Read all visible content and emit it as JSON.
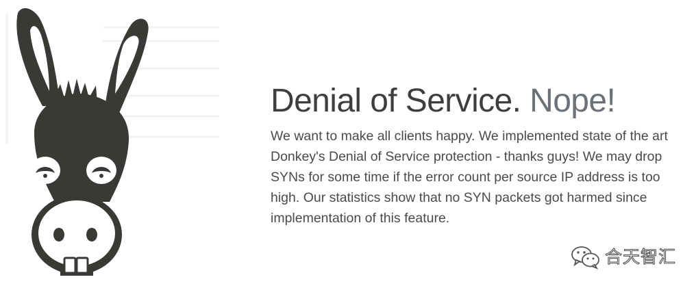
{
  "headline": {
    "main": "Denial of Service.",
    "accent": "Nope!"
  },
  "description": "We want to make all clients happy. We implemented state of the art Donkey's Denial of Service protection - thanks guys! We may drop SYNs for some time if the error count per source IP address is too high. Our statistics show that no SYN packets got harmed since implementation of this feature.",
  "watermark": {
    "icon": "wechat-icon",
    "text": "合天智汇"
  },
  "illustration": {
    "icon": "donkey-icon"
  },
  "colors": {
    "headline": "#3e3e3e",
    "accent": "#6b7176",
    "body": "#4a4a4a",
    "donkey": "#3b3936"
  }
}
